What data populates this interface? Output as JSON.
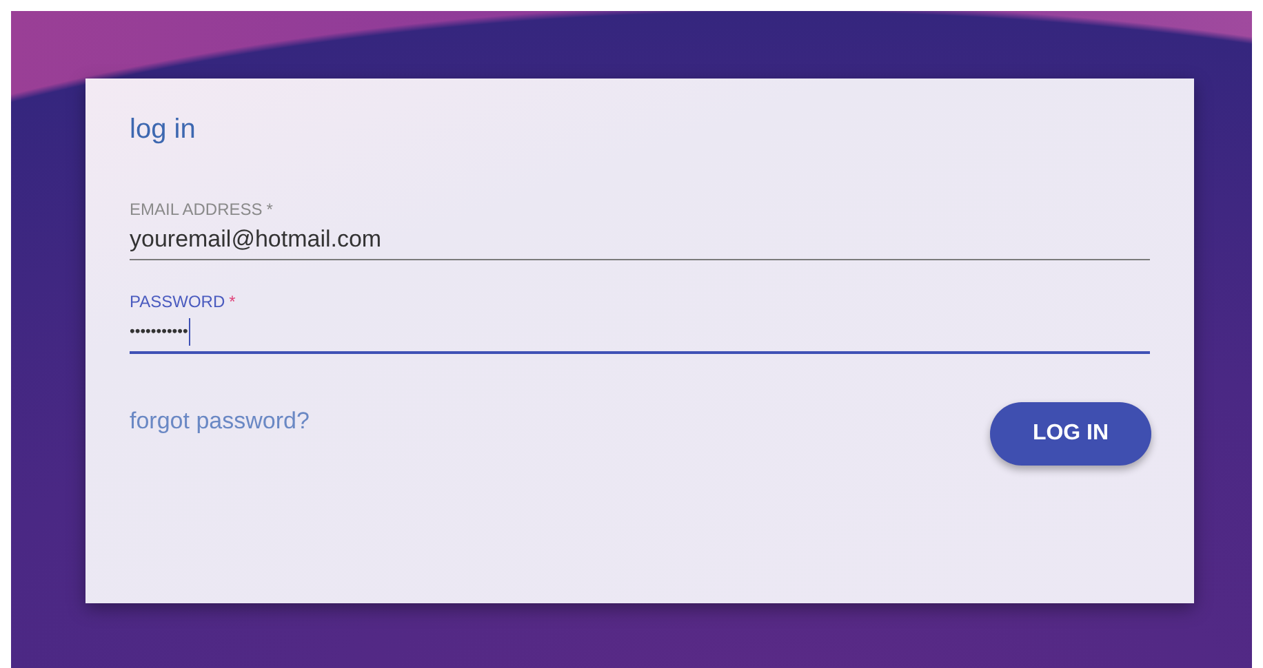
{
  "card": {
    "title": "log in",
    "fields": [
      {
        "kind": "text",
        "label": "EMAIL ADDRESS",
        "required_mark": "*",
        "value": "youremail@hotmail.com",
        "focused": false
      },
      {
        "kind": "password",
        "label": "PASSWORD",
        "required_mark": "*",
        "value": "•••••••••••",
        "focused": true
      }
    ],
    "forgot_link": "forgot password?",
    "submit_button": "LOG IN"
  }
}
